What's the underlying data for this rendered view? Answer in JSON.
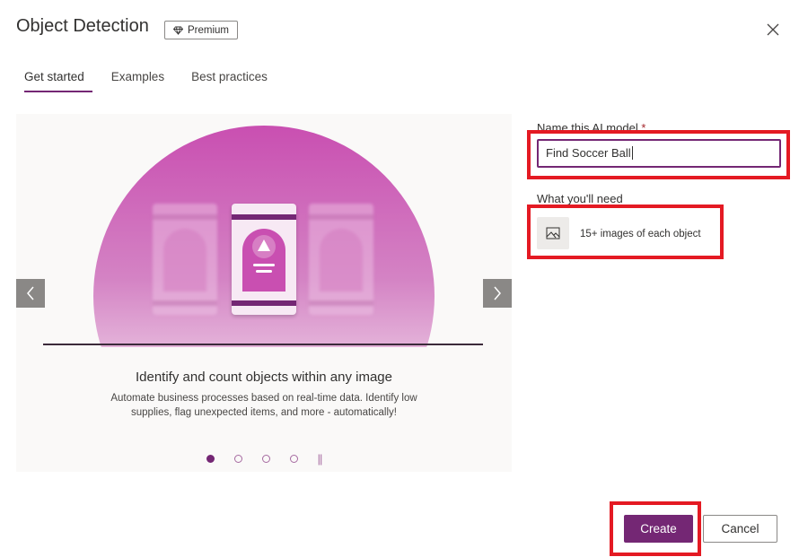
{
  "dialog": {
    "title": "Object Detection",
    "badge": {
      "icon": "diamond-icon",
      "label": "Premium"
    },
    "close_icon": "close-icon"
  },
  "tabs": [
    {
      "label": "Get started",
      "active": true
    },
    {
      "label": "Examples",
      "active": false
    },
    {
      "label": "Best practices",
      "active": false
    }
  ],
  "carousel": {
    "title": "Identify and count objects within any image",
    "description": "Automate business processes based on real-time data. Identify low supplies, flag unexpected items, and more - automatically!",
    "prev_icon": "chevron-left-icon",
    "next_icon": "chevron-right-icon",
    "slide_count": 4,
    "active_slide": 1,
    "pause_icon": "pause-icon"
  },
  "form": {
    "name_label": "Name this AI model",
    "required_mark": "*",
    "name_value": "Find Soccer Ball",
    "need_label": "What you'll need",
    "need_item": {
      "icon": "image-icon",
      "text": "15+ images of each object"
    }
  },
  "footer": {
    "create_label": "Create",
    "cancel_label": "Cancel"
  },
  "colors": {
    "accent": "#742774",
    "highlight": "#e41a23",
    "hero": "#c94fb1"
  }
}
